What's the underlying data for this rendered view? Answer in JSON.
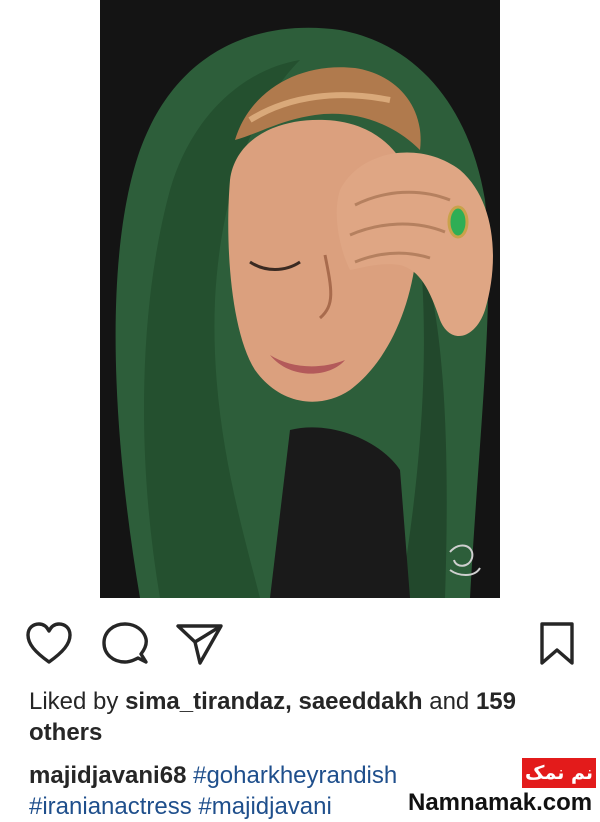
{
  "post": {
    "photo_icon": "portrait-photo"
  },
  "actions": {
    "like_icon": "heart-icon",
    "comment_icon": "comment-icon",
    "share_icon": "send-icon",
    "save_icon": "bookmark-icon"
  },
  "likes": {
    "prefix": "Liked by",
    "user1": "sima_tirandaz,",
    "user2": "saeeddakh",
    "connector": "and",
    "count": "159",
    "suffix": "others"
  },
  "caption": {
    "username": "majidjavani68",
    "tags": [
      "#goharkheyrandish",
      "#iranianactress",
      "#majidjavani"
    ]
  },
  "watermark": {
    "label": "نم نمک",
    "site": "Namnamak.com",
    "color": "#e31b1b"
  }
}
